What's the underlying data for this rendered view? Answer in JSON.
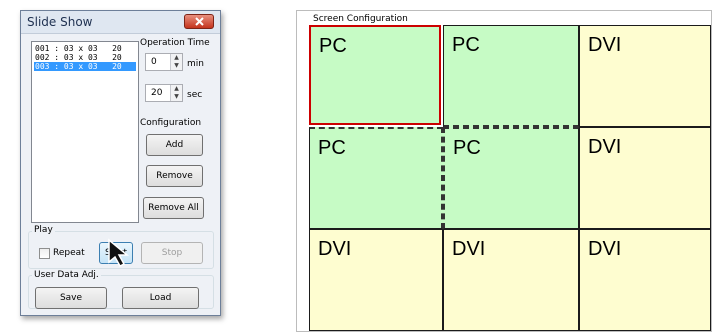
{
  "window": {
    "title": "Slide Show"
  },
  "list": {
    "items": [
      {
        "label": "001 : 03 x 03   20",
        "selected": false
      },
      {
        "label": "002 : 03 x 03   20",
        "selected": false
      },
      {
        "label": "003 : 03 x 03   20",
        "selected": true
      }
    ]
  },
  "operation_time": {
    "label": "Operation Time",
    "min_value": "0",
    "min_unit": "min",
    "sec_value": "20",
    "sec_unit": "sec"
  },
  "configuration": {
    "label": "Configuration",
    "add": "Add",
    "remove": "Remove",
    "remove_all": "Remove All"
  },
  "play": {
    "label": "Play",
    "repeat_label": "Repeat",
    "repeat_checked": false,
    "start": "Start",
    "stop": "Stop"
  },
  "user_data": {
    "label": "User Data Adj.",
    "save": "Save",
    "load": "Load"
  },
  "screen_config": {
    "title": "Screen Configuration",
    "cells": [
      {
        "label": "PC",
        "source": "pc",
        "selected": true
      },
      {
        "label": "PC",
        "source": "pc",
        "selected": false
      },
      {
        "label": "DVI",
        "source": "dvi",
        "selected": false
      },
      {
        "label": "PC",
        "source": "pc",
        "selected": false
      },
      {
        "label": "PC",
        "source": "pc",
        "selected": false
      },
      {
        "label": "DVI",
        "source": "dvi",
        "selected": false
      },
      {
        "label": "DVI",
        "source": "dvi",
        "selected": false
      },
      {
        "label": "DVI",
        "source": "dvi",
        "selected": false
      },
      {
        "label": "DVI",
        "source": "dvi",
        "selected": false
      }
    ]
  },
  "colors": {
    "pc_cell": "#c6fbc5",
    "dvi_cell": "#fefdd0",
    "selection_border": "#cc0000",
    "list_selection": "#3399ff"
  }
}
